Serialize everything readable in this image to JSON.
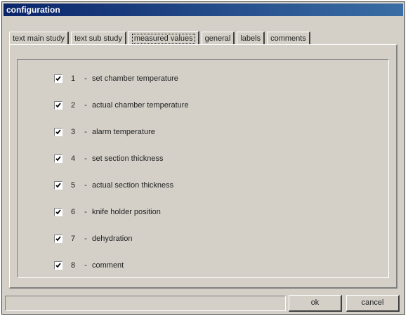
{
  "window": {
    "title": "configuration"
  },
  "tabs": [
    {
      "label": "text main study",
      "active": false
    },
    {
      "label": "text sub study",
      "active": false
    },
    {
      "label": "measured values",
      "active": true
    },
    {
      "label": "general",
      "active": false
    },
    {
      "label": "labels",
      "active": false
    },
    {
      "label": "comments",
      "active": false
    }
  ],
  "measured_values": [
    {
      "num": "1",
      "sep": "-",
      "label": "set chamber temperature",
      "checked": true
    },
    {
      "num": "2",
      "sep": "-",
      "label": "actual chamber temperature",
      "checked": true
    },
    {
      "num": "3",
      "sep": "-",
      "label": "alarm temperature",
      "checked": true
    },
    {
      "num": "4",
      "sep": "-",
      "label": "set section thickness",
      "checked": true
    },
    {
      "num": "5",
      "sep": "-",
      "label": "actual section thickness",
      "checked": true
    },
    {
      "num": "6",
      "sep": "-",
      "label": "knife holder position",
      "checked": true
    },
    {
      "num": "7",
      "sep": "-",
      "label": "dehydration",
      "checked": true
    },
    {
      "num": "8",
      "sep": "-",
      "label": "comment",
      "checked": true
    }
  ],
  "buttons": {
    "ok": "ok",
    "cancel": "cancel"
  }
}
